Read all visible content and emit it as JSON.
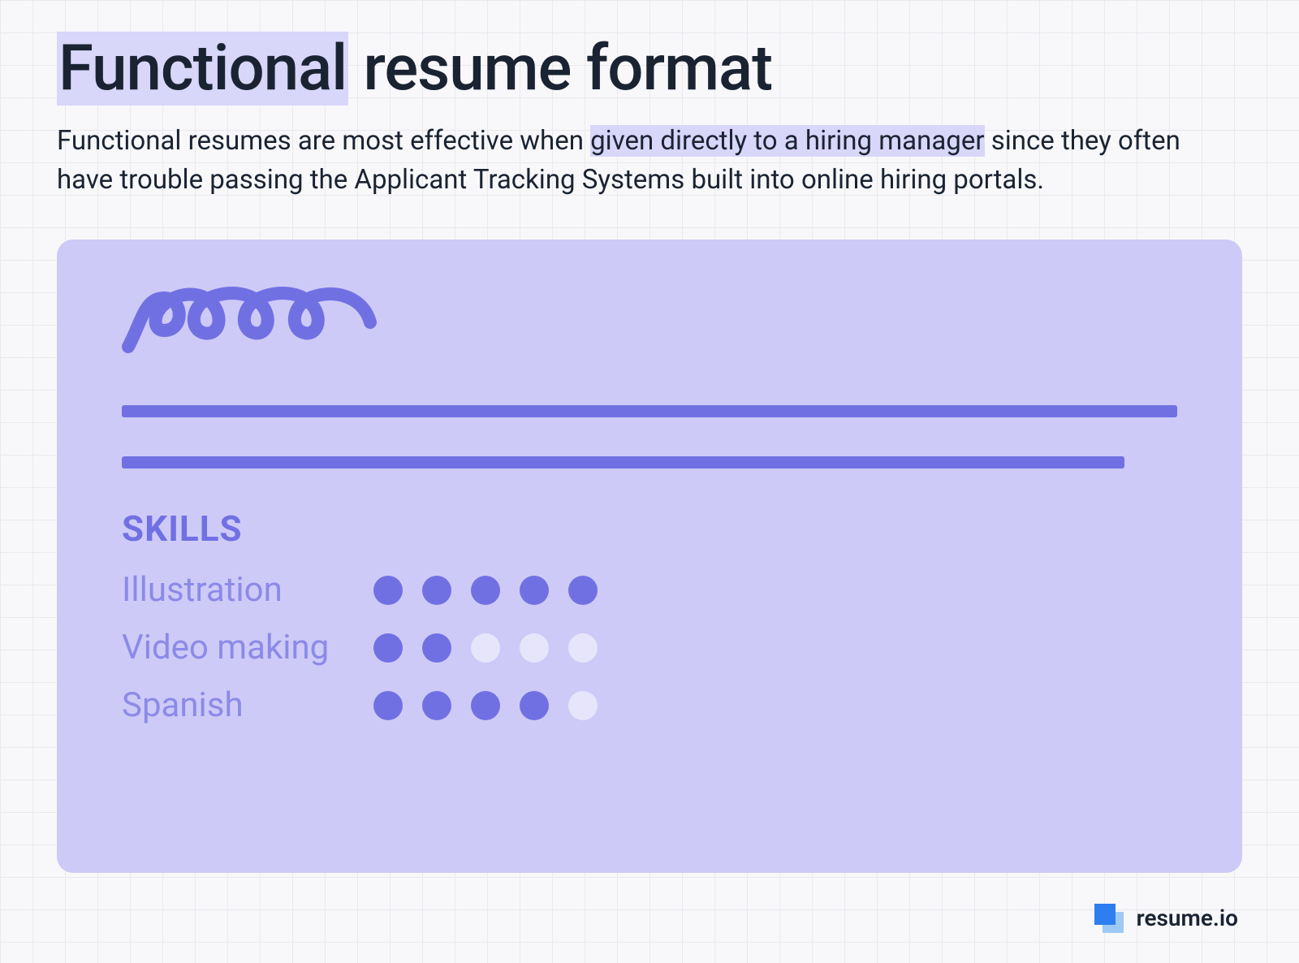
{
  "heading": {
    "highlighted": "Functional",
    "rest": " resume format"
  },
  "description": {
    "before": "Functional resumes are most effective when ",
    "highlighted": "given directly to a hiring manager",
    "after": " since they often have trouble passing the Applicant Tracking Systems built into online hiring portals."
  },
  "card": {
    "skills_heading": "SKILLS",
    "skills": [
      {
        "label": "Illustration",
        "level": 5,
        "max": 5
      },
      {
        "label": "Video making",
        "level": 2,
        "max": 5
      },
      {
        "label": "Spanish",
        "level": 4,
        "max": 5
      }
    ]
  },
  "footer": {
    "brand": "resume.io"
  },
  "colors": {
    "accent": "#7170e3",
    "card_bg": "#cdcaf7",
    "highlight_bg": "#d8d6f9",
    "text": "#1a2332"
  }
}
